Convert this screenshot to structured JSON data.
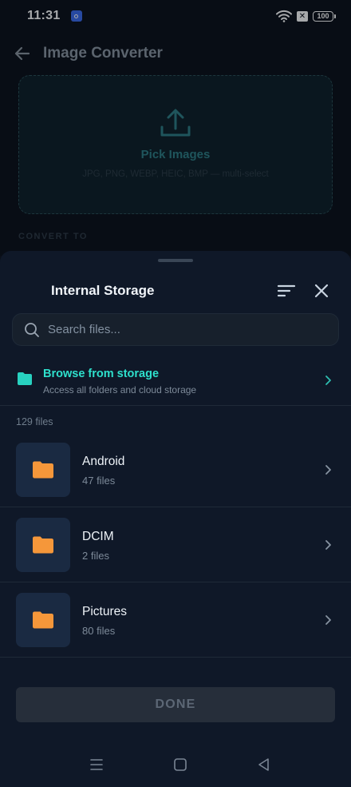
{
  "status_bar": {
    "time": "11:31",
    "battery": "100",
    "notification_glyph": "✕"
  },
  "app": {
    "title": "Image Converter",
    "pick_label": "Pick Images",
    "pick_hint": "JPG, PNG, WEBP, HEIC, BMP — multi-select",
    "convert_to_label": "CONVERT TO"
  },
  "sheet": {
    "title": "Internal Storage",
    "search_placeholder": "Search files...",
    "browse": {
      "title": "Browse from storage",
      "subtitle": "Access all folders and cloud storage"
    },
    "file_count": "129 files",
    "folders": [
      {
        "name": "Android",
        "count": "47 files"
      },
      {
        "name": "DCIM",
        "count": "2 files"
      },
      {
        "name": "Pictures",
        "count": "80 files"
      }
    ],
    "done_label": "DONE"
  },
  "colors": {
    "accent": "#2ee0cc",
    "folder": "#f5973a",
    "sheet_bg": "#0f1828"
  },
  "icons": [
    "back-arrow-icon",
    "upload-icon",
    "sort-icon",
    "close-icon",
    "search-icon",
    "folder-icon",
    "chevron-right-icon",
    "menu-icon",
    "home-icon",
    "back-triangle-icon"
  ]
}
